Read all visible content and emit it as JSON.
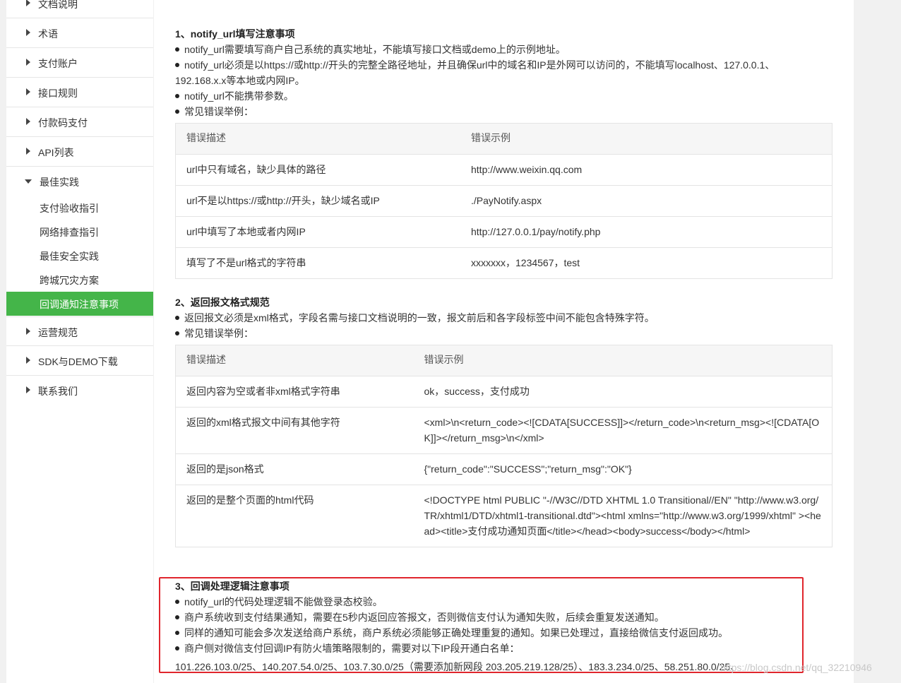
{
  "sidebar": {
    "items": [
      {
        "label": "文档说明"
      },
      {
        "label": "术语"
      },
      {
        "label": "支付账户"
      },
      {
        "label": "接口规则"
      },
      {
        "label": "付款码支付"
      },
      {
        "label": "API列表"
      },
      {
        "label": "最佳实践"
      },
      {
        "label": "运营规范"
      },
      {
        "label": "SDK与DEMO下载"
      },
      {
        "label": "联系我们"
      }
    ],
    "sub_items": [
      {
        "label": "支付验收指引"
      },
      {
        "label": "网络排查指引"
      },
      {
        "label": "最佳安全实践"
      },
      {
        "label": "跨城冗灾方案"
      },
      {
        "label": "回调通知注意事项"
      }
    ]
  },
  "section1": {
    "title": "1、notify_url填写注意事项",
    "bullets": [
      "notify_url需要填写商户自己系统的真实地址，不能填写接口文档或demo上的示例地址。",
      "notify_url必须是以https://或http://开头的完整全路径地址，并且确保url中的域名和IP是外网可以访问的，不能填写localhost、127.0.0.1、",
      "notify_url不能携带参数。",
      "常见错误举例："
    ],
    "bullet2_cont": "192.168.x.x等本地或内网IP。",
    "table": {
      "headers": [
        "错误描述",
        "错误示例"
      ],
      "rows": [
        [
          "url中只有域名，缺少具体的路径",
          "http://www.weixin.qq.com"
        ],
        [
          "url不是以https://或http://开头，缺少域名或IP",
          "./PayNotify.aspx"
        ],
        [
          "url中填写了本地或者内网IP",
          "http://127.0.0.1/pay/notify.php"
        ],
        [
          "填写了不是url格式的字符串",
          "xxxxxxx，1234567，test"
        ]
      ]
    }
  },
  "section2": {
    "title": "2、返回报文格式规范",
    "bullets": [
      "返回报文必须是xml格式，字段名需与接口文档说明的一致，报文前后和各字段标签中间不能包含特殊字符。",
      "常见错误举例："
    ],
    "table": {
      "headers": [
        "错误描述",
        "错误示例"
      ],
      "rows": [
        [
          "返回内容为空或者非xml格式字符串",
          "ok，success，支付成功"
        ],
        [
          "返回的xml格式报文中间有其他字符",
          "<xml>\\n<return_code><![CDATA[SUCCESS]]></return_code>\\n<return_msg><![CDATA[OK]]></return_msg>\\n</xml>"
        ],
        [
          "返回的是json格式",
          "{\"return_code\":\"SUCCESS\";\"return_msg\":\"OK\"}"
        ],
        [
          "返回的是整个页面的html代码",
          "<!DOCTYPE html PUBLIC \"-//W3C//DTD XHTML 1.0 Transitional//EN\" \"http://www.w3.org/TR/xhtml1/DTD/xhtml1-transitional.dtd\"><html xmlns=\"http://www.w3.org/1999/xhtml\" ><head><title>支付成功通知页面</title></head><body>success</body></html>"
        ]
      ]
    }
  },
  "section3": {
    "title": "3、回调处理逻辑注意事项",
    "bullets": [
      "notify_url的代码处理逻辑不能做登录态校验。",
      "商户系统收到支付结果通知，需要在5秒内返回应答报文，否则微信支付认为通知失败，后续会重复发送通知。",
      "同样的通知可能会多次发送给商户系统，商户系统必须能够正确处理重复的通知。如果已处理过，直接给微信支付返回成功。",
      "商户侧对微信支付回调IP有防火墙策略限制的，需要对以下IP段开通白名单："
    ],
    "ip_list": "101.226.103.0/25、140.207.54.0/25、103.7.30.0/25（需要添加新网段 203.205.219.128/25）、183.3.234.0/25、58.251.80.0/25、"
  },
  "watermark": "https://blog.csdn.net/qq_32210946"
}
